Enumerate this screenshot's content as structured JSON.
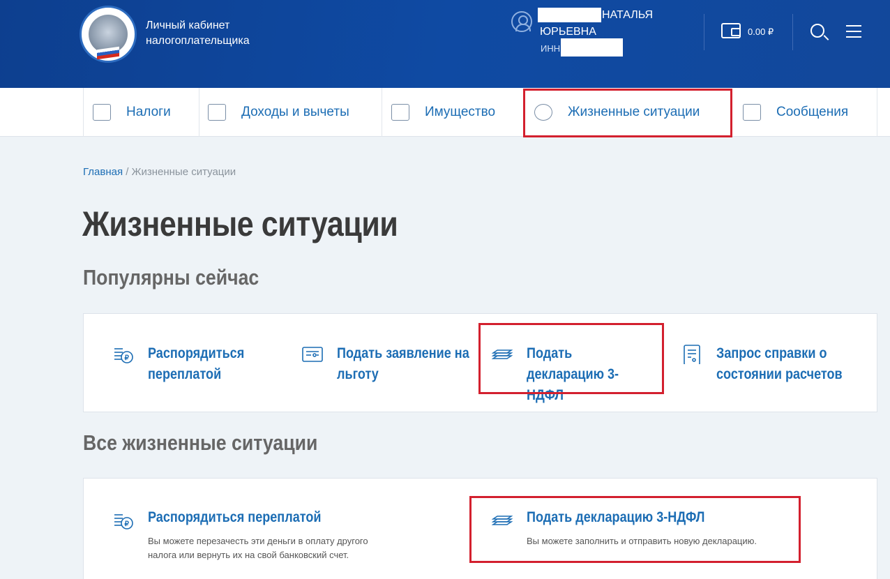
{
  "header": {
    "brand_line1": "Личный кабинет",
    "brand_line2": "налогоплательщика",
    "user_first": "НАТАЛЬЯ",
    "user_second": "ЮРЬЕВНА",
    "inn_label": "ИНН",
    "balance": "0.00 ₽"
  },
  "nav": {
    "items": [
      {
        "label": "Налоги",
        "icon": "calculator-icon"
      },
      {
        "label": "Доходы и вычеты",
        "icon": "ruble-doc-icon"
      },
      {
        "label": "Имущество",
        "icon": "house-icon"
      },
      {
        "label": "Жизненные ситуации",
        "icon": "person-question-icon"
      },
      {
        "label": "Сообщения",
        "icon": "envelope-icon"
      }
    ]
  },
  "breadcrumb": {
    "home": "Главная",
    "separator": " / ",
    "current": "Жизненные ситуации"
  },
  "page_title": "Жизненные ситуации",
  "popular": {
    "title": "Популярны сейчас",
    "items": [
      {
        "label": "Распорядиться переплатой",
        "icon": "coins-ruble-icon"
      },
      {
        "label": "Подать заявление на льготу",
        "icon": "form-icon"
      },
      {
        "label": "Подать декларацию 3-НДФЛ",
        "icon": "declaration-icon"
      },
      {
        "label": "Запрос справки о состоянии расчетов",
        "icon": "document-list-icon"
      }
    ]
  },
  "all": {
    "title": "Все жизненные ситуации",
    "items": [
      {
        "label": "Распорядиться переплатой",
        "desc": "Вы можете перезачесть эти деньги в оплату другого налога или вернуть их на свой банковский счет.",
        "icon": "coins-ruble-icon"
      },
      {
        "label": "Подать декларацию 3-НДФЛ",
        "desc": "Вы можете заполнить и отправить новую декларацию.",
        "icon": "declaration-icon"
      }
    ]
  },
  "colors": {
    "header_blue": "#0f4aa3",
    "link_blue": "#1c6db4",
    "highlight_red": "#d3202e"
  }
}
